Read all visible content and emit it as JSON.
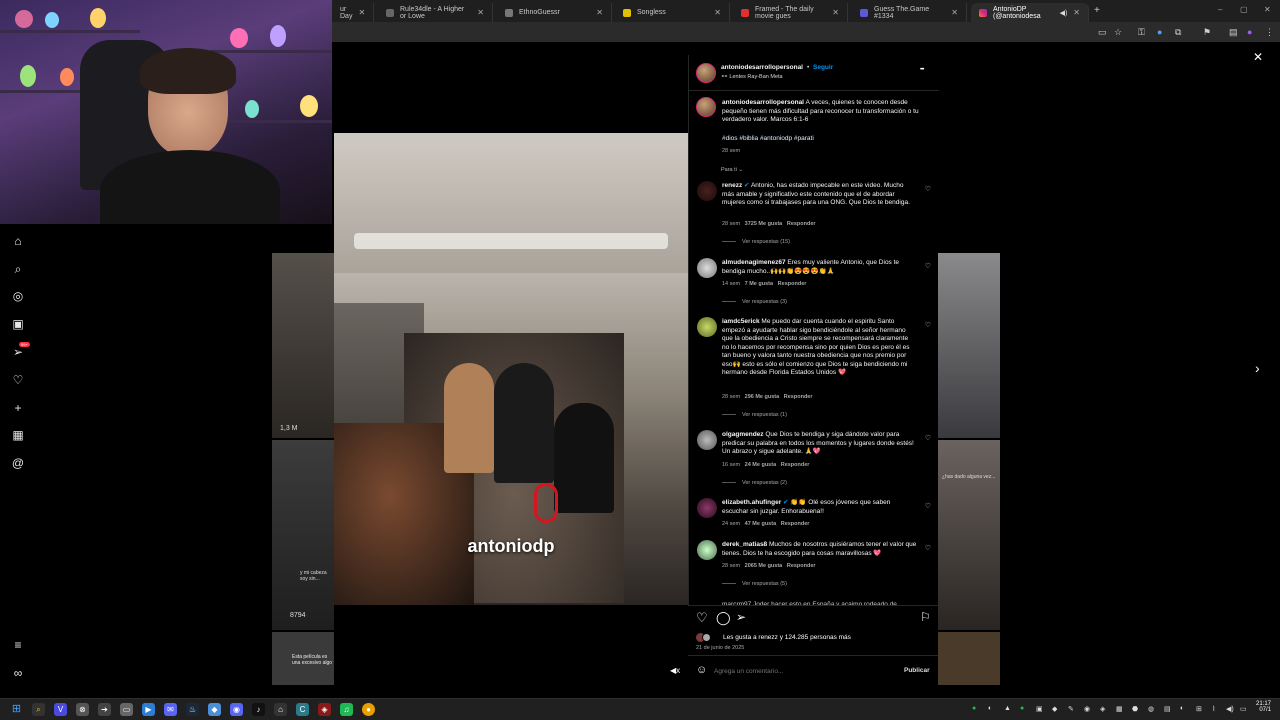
{
  "browser": {
    "tabs": [
      {
        "title": "ur Day",
        "active": false
      },
      {
        "title": "Rule34dle - A Higher or Lowe",
        "active": false
      },
      {
        "title": "EthnoGuessr",
        "active": false
      },
      {
        "title": "Songless",
        "active": false
      },
      {
        "title": "Framed - The daily movie gues",
        "active": false
      },
      {
        "title": "Guess The.Game #1334",
        "active": false
      },
      {
        "title": "AntonioDP (@antoniodesa",
        "active": true
      }
    ],
    "new_tab": "+",
    "window_controls": {
      "minimize": "–",
      "maximize": "▢",
      "close": "✕"
    }
  },
  "icons": {
    "home": "home-icon",
    "search": "search-icon",
    "explore": "compass-icon",
    "reels": "reels-icon",
    "messages": "send-icon",
    "notifications": "heart-icon",
    "create": "plus-icon",
    "dashboard": "dashboard-icon",
    "threads": "threads-icon",
    "menu": "menu-icon",
    "meta": "meta-icon"
  },
  "nav": {
    "messages_badge": "99+"
  },
  "close_label": "✕",
  "next_label": "›",
  "background": {
    "thumb_views_1": "1,3 M",
    "thumb_views_2": "8794",
    "thumb_caption_1": "Esta película es una excesivo algo",
    "thumb_caption_2": "y mi cabeza soy sin...",
    "thumb_caption_3": "¿has dado alguna vez..."
  },
  "video": {
    "overlay_text": "antoniodp",
    "mute_icon": "mute-icon"
  },
  "post": {
    "author": "antoniodesarrollopersonal",
    "dot": "•",
    "follow_label": "Seguir",
    "subtitle": "Lentes Ray-Ban Meta",
    "more_label": "•••",
    "caption_user": "antoniodesarrollopersonal",
    "caption_text": "A veces, quienes te conocen desde pequeño tienen más dificultad para reconocer tu transformación o tu verdadero valor. Marcos 6:1-6",
    "hashtags": "#dios #biblia #antoniodp #parati",
    "caption_time": "28 sem",
    "sort_label": "Para ti ⌄",
    "comments": [
      {
        "user": "renezz",
        "verified": true,
        "text": "Antonio, has estado impecable en este video. Mucho más amable y significativo este contenido que el de abordar mujeres como si trabajases para una ONG. Que Dios te bendiga.",
        "time": "28 sem",
        "likes": "3725 Me gusta",
        "reply": "Responder",
        "replies": "Ver respuestas (15)"
      },
      {
        "user": "almudenagimenez67",
        "verified": false,
        "text": "Eres muy valiente Antonio, que Dios te bendiga mucho..🙌🙌👏😍😍😍👏🙏",
        "time": "14 sem",
        "likes": "7 Me gusta",
        "reply": "Responder",
        "replies": "Ver respuestas (3)"
      },
      {
        "user": "iamdc5erick",
        "verified": false,
        "text": "Me puedo dar cuenta cuando el espiritu Santo empezó a ayudarte hablar sigo bendiciéndole al señor hermano que la obediencia a Cristo siempre se recompensará claramente no lo hacemos por recompensa sino por quien Dios es pero él es tan bueno y valora tanto nuestra obediencia que nos premio por eso🙌 esto es sólo el comienzo que Dios te siga bendiciendo mi hermano desde Florida Estados Unidos 💖",
        "time": "28 sem",
        "likes": "296 Me gusta",
        "reply": "Responder",
        "replies": "Ver respuestas (1)"
      },
      {
        "user": "olgagmendez",
        "verified": false,
        "text": "Que Dios te bendiga y siga dándote valor para predicar su palabra en todos los momentos y lugares donde estés! Un abrazo y sigue adelante. 🙏💖",
        "time": "16 sem",
        "likes": "24 Me gusta",
        "reply": "Responder",
        "replies": "Ver respuestas (2)"
      },
      {
        "user": "elizabeth.ahufinger",
        "verified": true,
        "text": "👏👏 Olé esos jóvenes que saben escuchar sin juzgar. Enhorabuena!!",
        "time": "24 sem",
        "likes": "47 Me gusta",
        "reply": "Responder",
        "replies": ""
      },
      {
        "user": "derek_matias8",
        "verified": false,
        "text": "Muchos de nosotros quisiéramos tener el valor que tienes. Dios te ha escogido para cosas maravillosas 💖",
        "time": "28 sem",
        "likes": "2065 Me gusta",
        "reply": "Responder",
        "replies": "Ver respuestas (5)"
      }
    ],
    "partial_comment": "marcrm97 Joder hacer esto en España y acaimo rodeado de",
    "likes_text": "Les gusta a renezz y 124.285 personas más",
    "date": "21 de junio de 2025",
    "comment_placeholder": "Agrega un comentario...",
    "publish_label": "Publicar"
  },
  "taskbar": {
    "time": "21:17",
    "date": "07/1"
  }
}
